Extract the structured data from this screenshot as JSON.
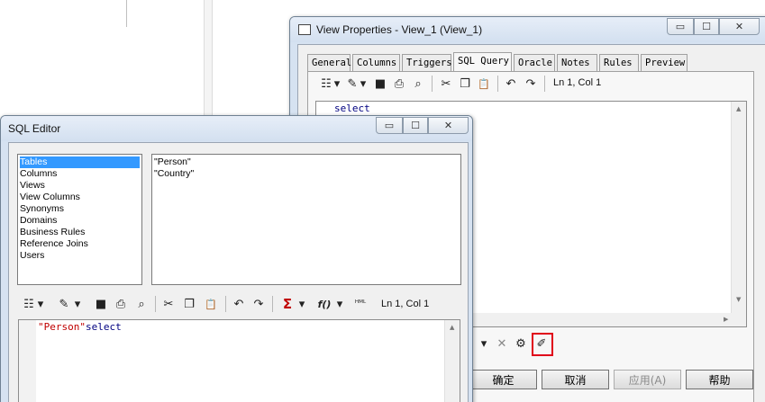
{
  "view_properties": {
    "title": "View Properties - View_1 (View_1)",
    "window_controls": {
      "minimize": "▭",
      "maximize": "☐",
      "close": "✕"
    },
    "tabs": [
      "General",
      "Columns",
      "Triggers",
      "SQL Query",
      "Oracle",
      "Notes",
      "Rules",
      "Preview"
    ],
    "active_tab": "SQL Query",
    "cursor_position": "Ln 1, Col 1",
    "query_text": "select",
    "buttons": {
      "ok": "确定",
      "cancel": "取消",
      "apply": "应用(A)",
      "help": "帮助"
    },
    "icons": {
      "properties": "☷",
      "dropdown": "▾",
      "edit": "✎",
      "save": "■",
      "print": "⎙",
      "find": "⌕",
      "cut": "✂",
      "copy": "❐",
      "paste": "📋",
      "undo": "↶",
      "redo": "↷",
      "delete": "✕",
      "settings": "⚙",
      "magic": "✐"
    }
  },
  "sql_editor": {
    "title": "SQL Editor",
    "window_controls": {
      "minimize": "▭",
      "maximize": "☐",
      "close": "✕"
    },
    "categories": [
      "Tables",
      "Columns",
      "Views",
      "View Columns",
      "Synonyms",
      "Domains",
      "Business Rules",
      "Reference Joins",
      "Users"
    ],
    "selected_category": "Tables",
    "objects": [
      "\"Person\"",
      "\"Country\""
    ],
    "cursor_position": "Ln 1, Col 1",
    "code_quoted": "\"Person\"",
    "code_rest": "select",
    "icons": {
      "properties": "☷",
      "dropdown": "▾",
      "edit": "✎",
      "save": "■",
      "print": "⎙",
      "find": "⌕",
      "cut": "✂",
      "copy": "❐",
      "paste": "📋",
      "undo": "↶",
      "redo": "↷",
      "sum": "Σ",
      "function": "f()",
      "sql": "ᴴᴹᴸ"
    }
  },
  "colors": {
    "accent_red": "#e0001a",
    "selection": "#3399ff",
    "sql_keyword": "#000080",
    "sql_string": "#c00000"
  }
}
